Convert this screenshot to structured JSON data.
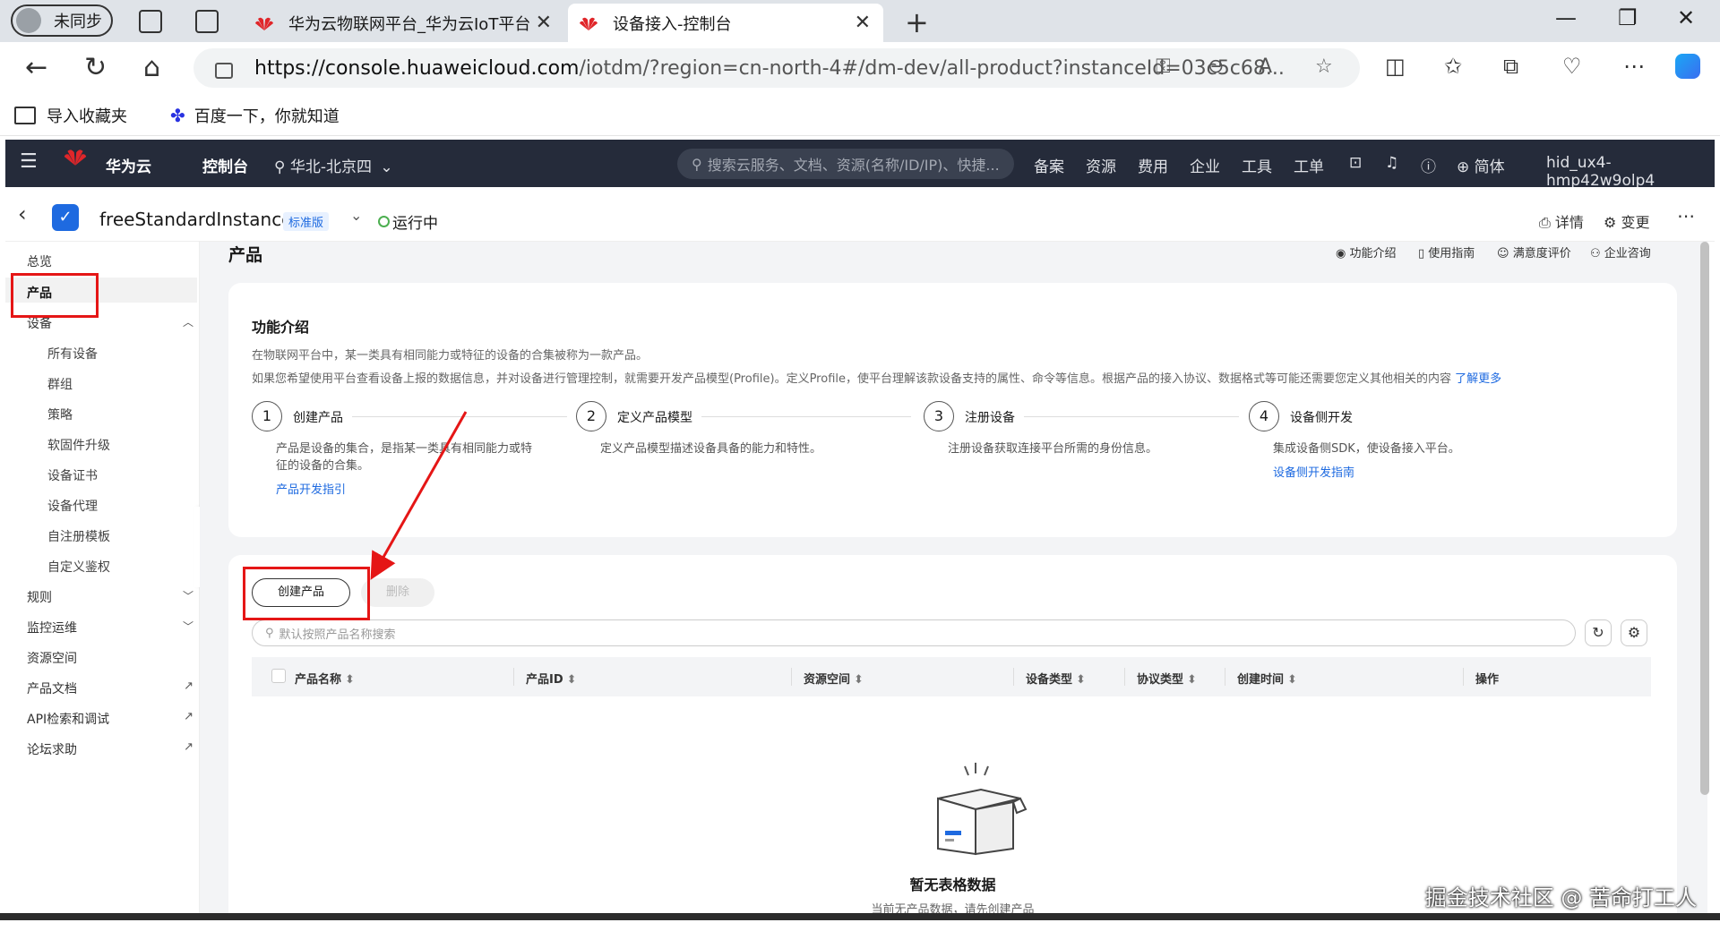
{
  "browser": {
    "profile_label": "未同步",
    "tabs": [
      {
        "title": "华为云物联网平台_华为云IoT平台",
        "active": false
      },
      {
        "title": "设备接入-控制台",
        "active": true
      }
    ],
    "url_host": "https://console.huaweicloud.com",
    "url_path": "/iotdm/?region=cn-north-4#/dm-dev/all-product?instanceId=03c5c68...",
    "bookmarks": [
      "导入收藏夹",
      "百度一下，你就知道"
    ]
  },
  "topnav": {
    "brand": "华为云",
    "console": "控制台",
    "region": "华北-北京四",
    "search_placeholder": "搜索云服务、文档、资源(名称/ID/IP)、快捷...",
    "items": [
      "备案",
      "资源",
      "费用",
      "企业",
      "工具",
      "工单"
    ],
    "language": "简体",
    "user": "hid_ux4-hmp42w9olp4"
  },
  "instance": {
    "name": "freeStandardInstance",
    "badge": "标准版",
    "status": "运行中",
    "actions": [
      "详情",
      "变更"
    ]
  },
  "sidebar": {
    "overview": "总览",
    "product": "产品",
    "device": "设备",
    "device_children": [
      "所有设备",
      "群组",
      "策略",
      "软固件升级",
      "设备证书",
      "设备代理",
      "自注册模板",
      "自定义鉴权"
    ],
    "rules": "规则",
    "monitor": "监控运维",
    "resource_space": "资源空间",
    "doc": "产品文档",
    "api": "API检索和调试",
    "forum": "论坛求助"
  },
  "page": {
    "title": "产品",
    "top_links": [
      "功能介绍",
      "使用指南",
      "满意度评价",
      "企业咨询"
    ],
    "intro": {
      "title": "功能介绍",
      "line1": "在物联网平台中，某一类具有相同能力或特征的设备的合集被称为一款产品。",
      "line2": "如果您希望使用平台查看设备上报的数据信息，并对设备进行管理控制，就需要开发产品模型(Profile)。定义Profile，使平台理解该款设备支持的属性、命令等信息。根据产品的接入协议、数据格式等可能还需要您定义其他相关的内容",
      "learn_more": "了解更多",
      "steps": [
        {
          "num": "1",
          "title": "创建产品",
          "desc1": "产品是设备的集合，是指某一类具有相同能力或特",
          "desc2": "征的设备的合集。",
          "link": "产品开发指引"
        },
        {
          "num": "2",
          "title": "定义产品模型",
          "desc1": "定义产品模型描述设备具备的能力和特性。",
          "desc2": "",
          "link": ""
        },
        {
          "num": "3",
          "title": "注册设备",
          "desc1": "注册设备获取连接平台所需的身份信息。",
          "desc2": "",
          "link": ""
        },
        {
          "num": "4",
          "title": "设备侧开发",
          "desc1": "集成设备侧SDK，使设备接入平台。",
          "desc2": "",
          "link": "设备侧开发指南"
        }
      ]
    },
    "table": {
      "create_button": "创建产品",
      "delete_button": "删除",
      "search_placeholder": "默认按照产品名称搜索",
      "columns": [
        "产品名称",
        "产品ID",
        "资源空间",
        "设备类型",
        "协议类型",
        "创建时间",
        "操作"
      ],
      "empty_title": "暂无表格数据",
      "empty_sub": "当前无产品数据，请先创建产品"
    }
  },
  "watermark": "掘金技术社区 @ 苦命打工人",
  "colors": {
    "accent": "#1e6ae0",
    "nav_bg": "#252b3a",
    "annotation": "#e51616"
  }
}
